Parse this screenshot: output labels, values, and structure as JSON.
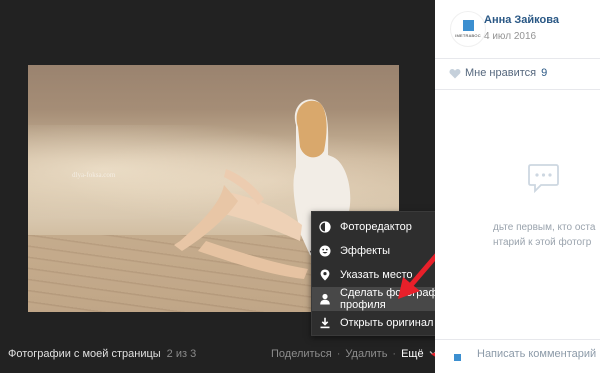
{
  "viewer": {
    "watermark": "dlya-foksa.com",
    "caption": "Фотографии с моей страницы",
    "counter": "2 из 3",
    "actions": {
      "share": "Поделиться",
      "delete": "Удалить",
      "more": "Ещё"
    }
  },
  "menu": {
    "items": [
      {
        "label": "Фоторедактор",
        "icon": "contrast-icon"
      },
      {
        "label": "Эффекты",
        "icon": "smiley-icon"
      },
      {
        "label": "Указать место",
        "icon": "location-pin-icon"
      },
      {
        "label": "Сделать фотографией профиля",
        "icon": "user-icon",
        "highlighted": true
      },
      {
        "label": "Открыть оригинал",
        "icon": "download-icon"
      }
    ]
  },
  "panel": {
    "author": "Анна Зайкова",
    "date": "4 июл 2016",
    "avatar_text": "IMETRABOC",
    "like_label": "Мне нравится",
    "like_count": "9",
    "empty_line1": "дьте первым, кто оста",
    "empty_line2": "нтарий к этой фотогр",
    "comment_placeholder": "Написать комментарий..."
  },
  "colors": {
    "link": "#2a5885",
    "viewer_bg": "#222222",
    "menu_bg": "#2e2e2e",
    "arrow": "#e8202a"
  }
}
